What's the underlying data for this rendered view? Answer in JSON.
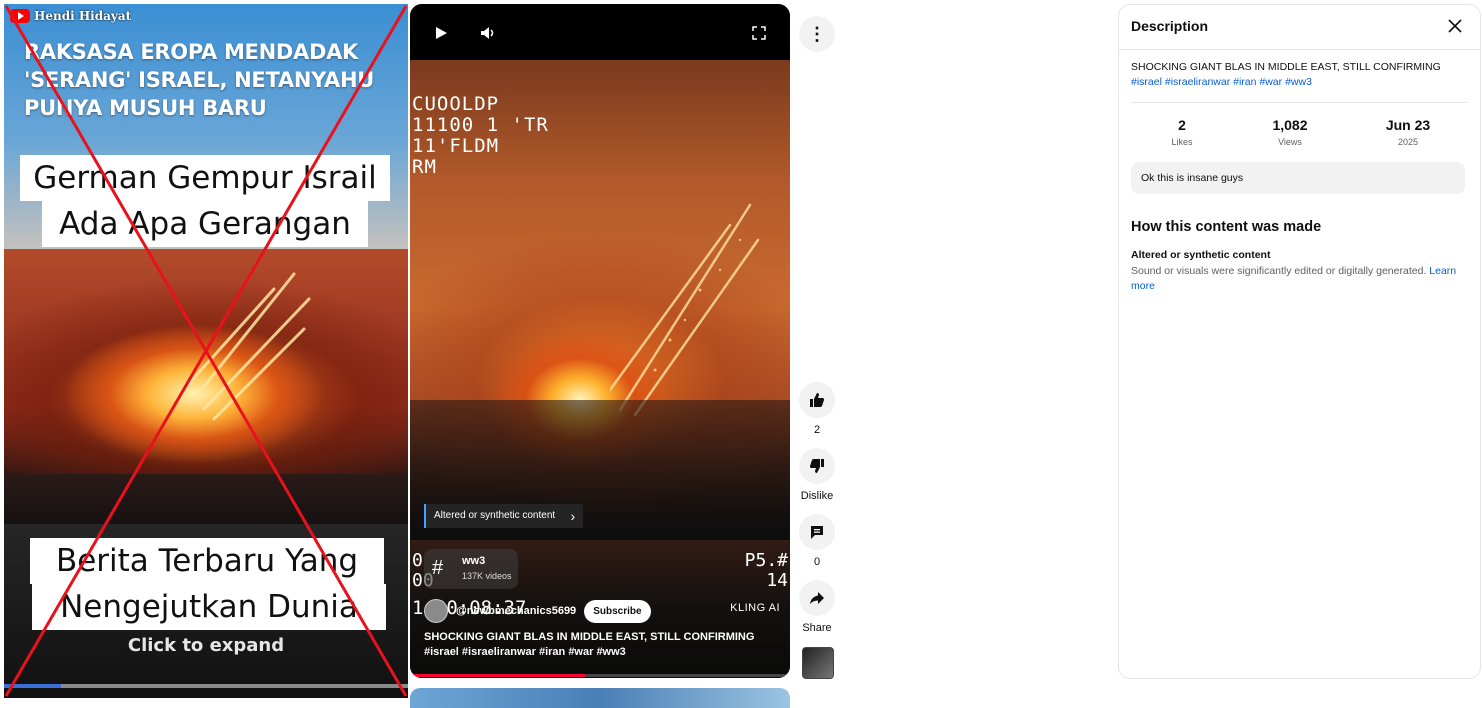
{
  "left_thumbnail": {
    "channel_name": "Hendi Hidayat",
    "headline": "RAKSASA EROPA MENDADAK\n'SERANG' ISRAEL, NETANYAHU\nPUNYA MUSUH BARU",
    "caption_top_line1": "German Gempur Israil",
    "caption_top_line2": "Ada Apa Gerangan",
    "caption_bottom_line1": "Berita Terbaru Yang",
    "caption_bottom_line2": "Nengejutkan Dunia",
    "expand_label": "Click to expand",
    "progress_fraction": 0.14,
    "overlay_mark": "red-x"
  },
  "player": {
    "glitch_text": "CUOOLDP\n11100 1 'TR\n11'FLDM\nRM",
    "left_edge_text": "0\n00",
    "timestamp_text": "1 00:08:37",
    "right_edge_text": "P5.#\n14",
    "synthetic_label": "Altered or synthetic content",
    "tag_name": "ww3",
    "tag_count": "137K videos",
    "channel_handle": "@newbmechanics5699",
    "subscribe_label": "Subscribe",
    "watermark": "KLING AI",
    "caption_text": "SHOCKING GIANT BLAS IN MIDDLE EAST, STILL CONFIRMING ",
    "caption_tags": "#israel #israeliranwar #iran #war #ww3",
    "progress_fraction": 0.46
  },
  "actions": {
    "like_count": "2",
    "dislike_label": "Dislike",
    "comment_count": "0",
    "share_label": "Share"
  },
  "description": {
    "title": "Description",
    "text": "SHOCKING GIANT BLAS IN MIDDLE EAST, STILL CONFIRMING ",
    "tags": "#israel #israeliranwar #iran #war #ww3",
    "likes_value": "2",
    "likes_label": "Likes",
    "views_value": "1,082",
    "views_label": "Views",
    "date_value": "Jun 23",
    "date_year": "2025",
    "pinned_comment": "Ok this is insane guys",
    "how_made_title": "How this content was made",
    "altered_title": "Altered or synthetic content",
    "altered_text": "Sound or visuals were significantly edited or digitally generated. ",
    "learn_more": "Learn more"
  },
  "colors": {
    "link_blue": "#065fd4",
    "youtube_red": "#ff0000",
    "progress_red": "#ff0033"
  }
}
